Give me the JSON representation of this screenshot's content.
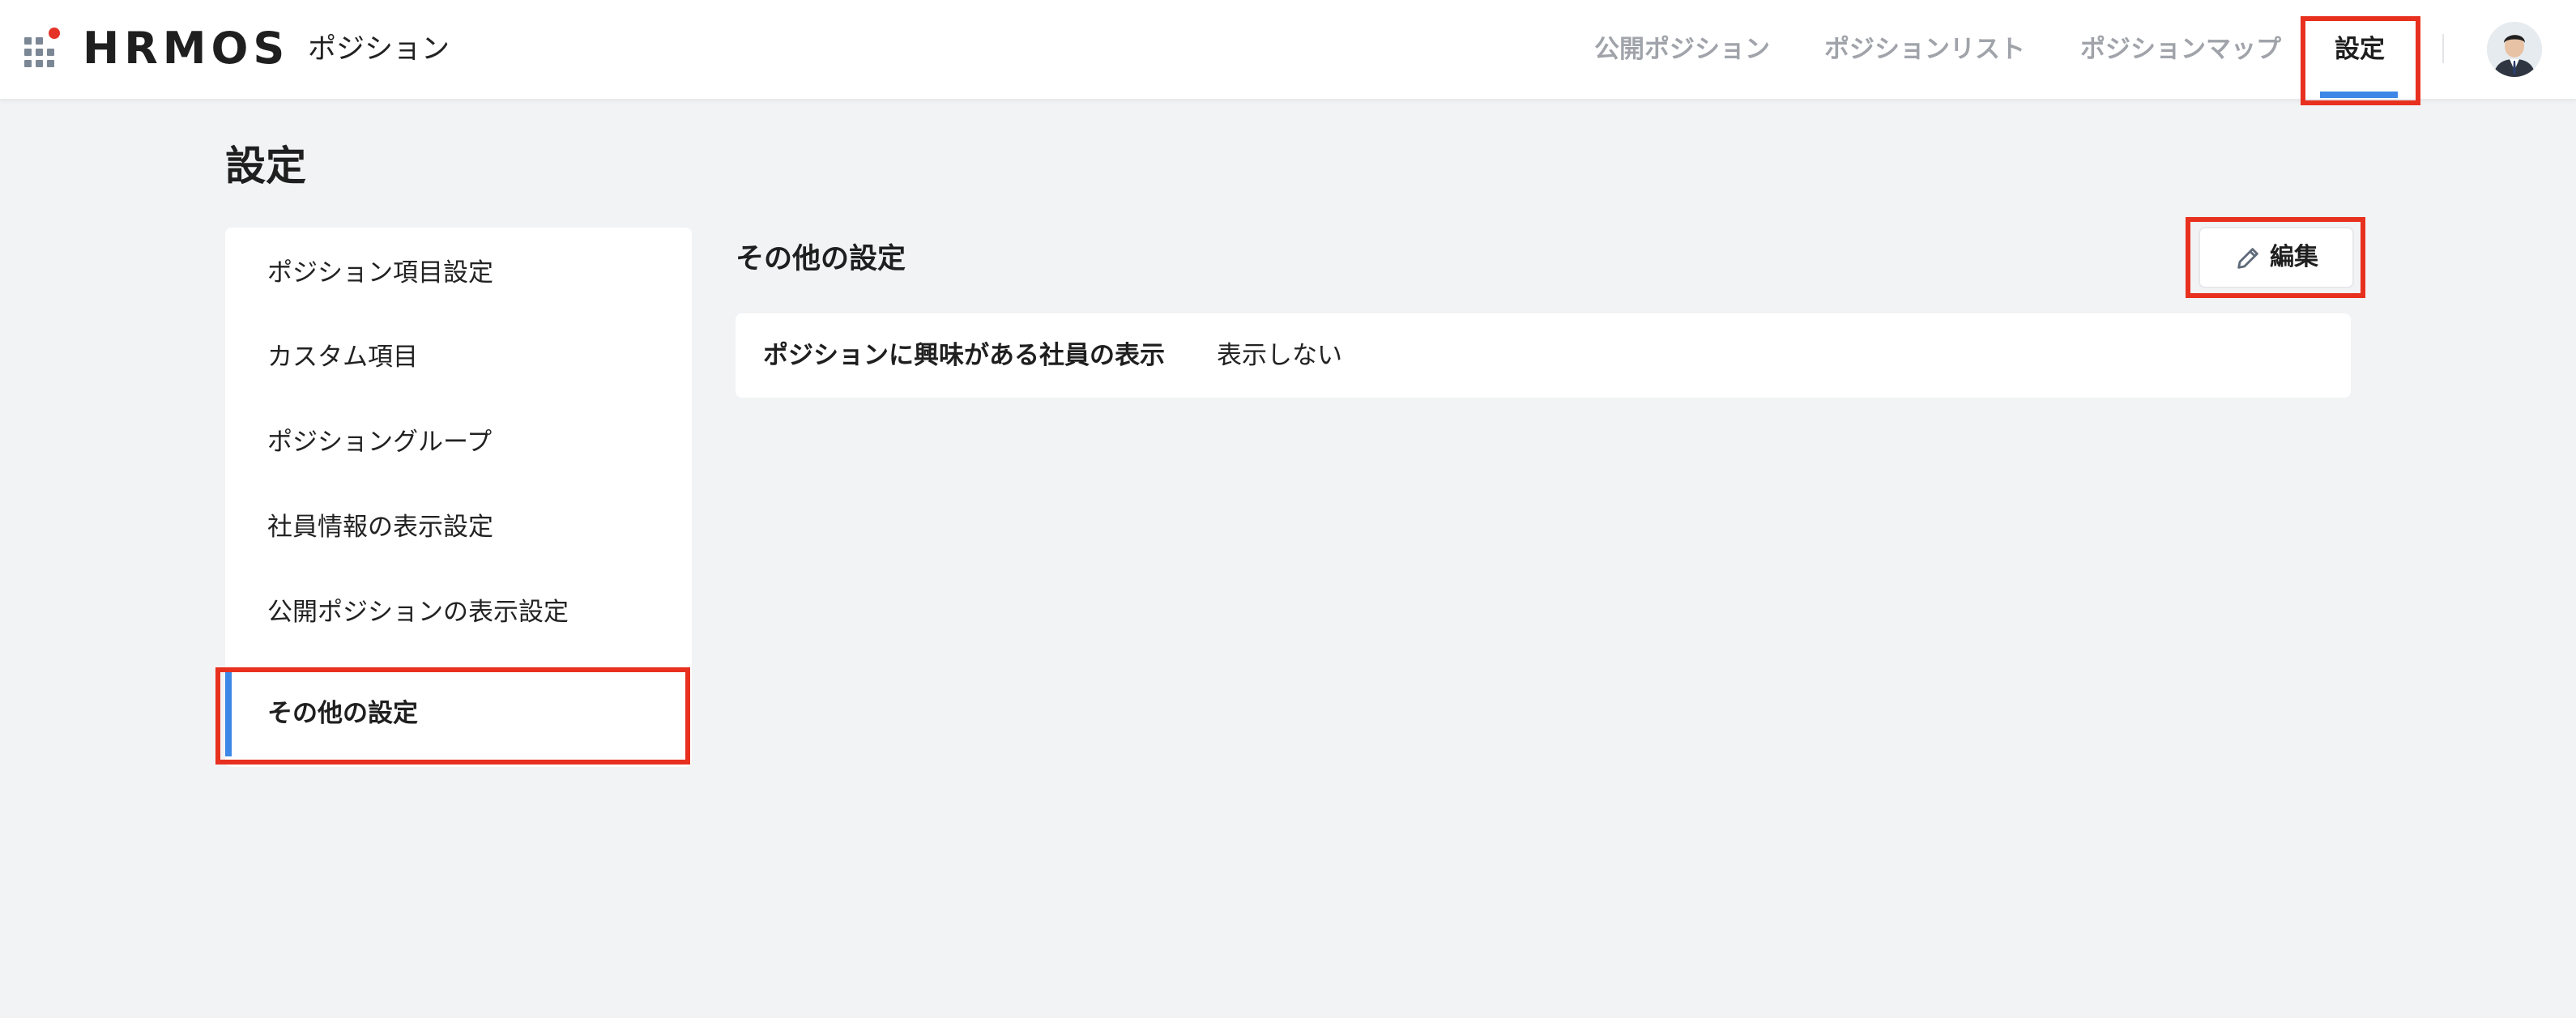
{
  "header": {
    "logo_text": "HRMOS",
    "product_name": "ポジション",
    "nav": [
      {
        "label": "公開ポジション"
      },
      {
        "label": "ポジションリスト"
      },
      {
        "label": "ポジションマップ"
      },
      {
        "label": "設定"
      }
    ],
    "active_nav": "設定",
    "icons": {
      "launcher": "app-launcher-grid-icon",
      "avatar": "user-avatar"
    }
  },
  "page": {
    "title": "設定"
  },
  "sidebar": {
    "items": [
      {
        "label": "ポジション項目設定"
      },
      {
        "label": "カスタム項目"
      },
      {
        "label": "ポジショングループ"
      },
      {
        "label": "社員情報の表示設定"
      },
      {
        "label": "公開ポジションの表示設定"
      },
      {
        "label": "その他の設定"
      }
    ],
    "active": "その他の設定"
  },
  "content": {
    "section_title": "その他の設定",
    "edit_label": "編集",
    "rows": [
      {
        "key": "ポジションに興味がある社員の表示",
        "value": "表示しない"
      }
    ]
  },
  "colors": {
    "accent": "#3d87e6",
    "highlight_box": "#e8301f",
    "background": "#f2f3f5",
    "brand_dot": "#e53327"
  }
}
